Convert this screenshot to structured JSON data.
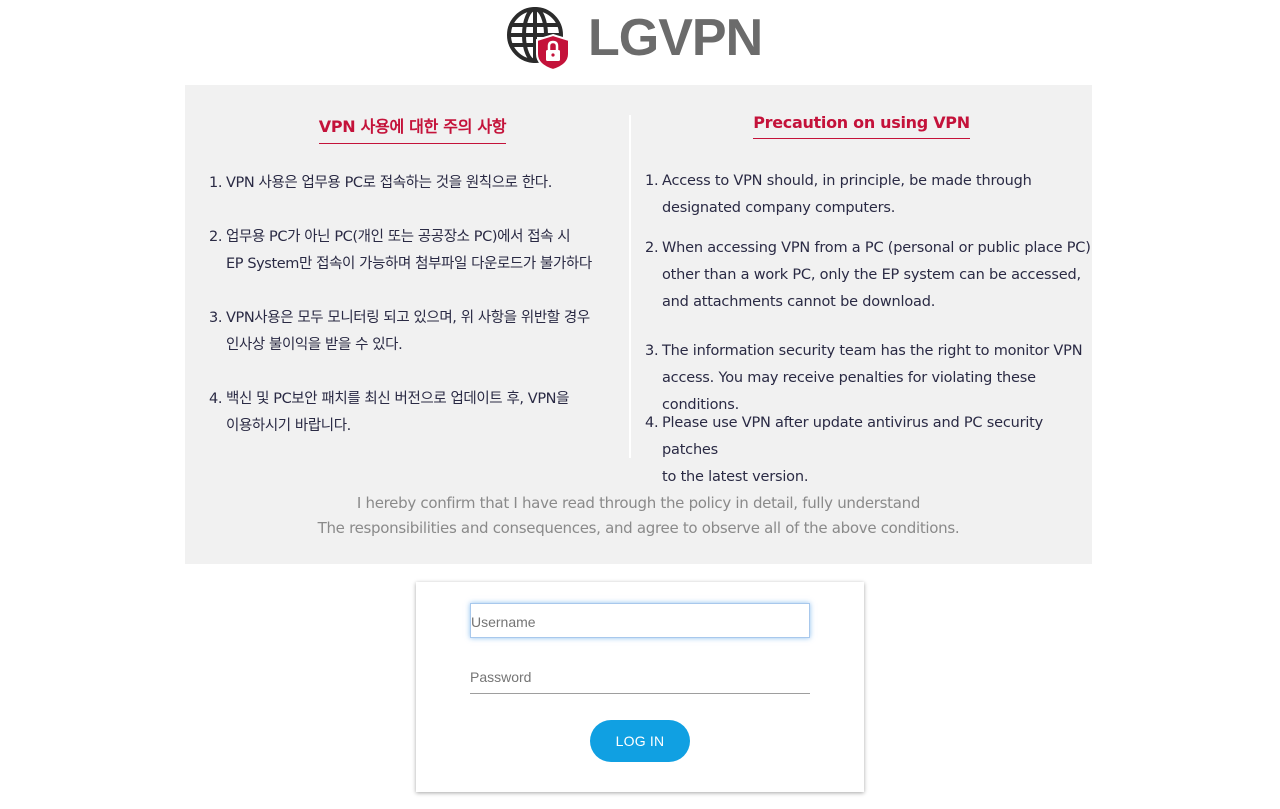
{
  "brand": {
    "logo_text": "LGVPN",
    "logo_icon": "globe-lock-icon",
    "accent": "#c4123a",
    "button_color": "#10a0e2"
  },
  "notice": {
    "korean": {
      "title": "VPN 사용에 대한 주의 사항",
      "items": [
        {
          "num": "1.",
          "lines": [
            "VPN 사용은 업무용 PC로 접속하는 것을 원칙으로 한다."
          ]
        },
        {
          "num": "2.",
          "lines": [
            "업무용 PC가 아닌 PC(개인 또는 공공장소 PC)에서 접속 시",
            "EP System만 접속이 가능하며 첨부파일 다운로드가 불가하다"
          ]
        },
        {
          "num": "3.",
          "lines": [
            "VPN사용은 모두 모니터링 되고 있으며, 위 사항을 위반할 경우",
            "인사상 불이익을 받을 수 있다."
          ]
        },
        {
          "num": "4.",
          "lines": [
            "백신 및 PC보안 패치를 최신 버전으로 업데이트 후, VPN을",
            "이용하시기 바랍니다."
          ]
        }
      ]
    },
    "english": {
      "title": "Precaution on using VPN",
      "items": [
        {
          "num": "1.",
          "lines": [
            "Access to VPN should, in principle, be made through",
            "designated company computers."
          ]
        },
        {
          "num": "2.",
          "lines": [
            "When accessing VPN from a PC (personal or public place PC)",
            "other than a work PC, only the EP system can be accessed,",
            "and attachments cannot be download."
          ]
        },
        {
          "num": "3.",
          "lines": [
            "The information security team has the right to monitor VPN",
            "access. You may receive penalties for violating these conditions."
          ]
        },
        {
          "num": "4.",
          "lines": [
            "Please use VPN after update antivirus and PC security patches",
            "to the latest version."
          ]
        }
      ]
    },
    "confirm_lines": [
      "I hereby confirm that I have read through the policy in detail, fully understand",
      "The responsibilities and consequences, and agree to observe all of the above conditions."
    ]
  },
  "login": {
    "username_placeholder": "Username",
    "username_value": "",
    "password_placeholder": "Password",
    "password_value": "",
    "button_label": "LOG IN"
  }
}
